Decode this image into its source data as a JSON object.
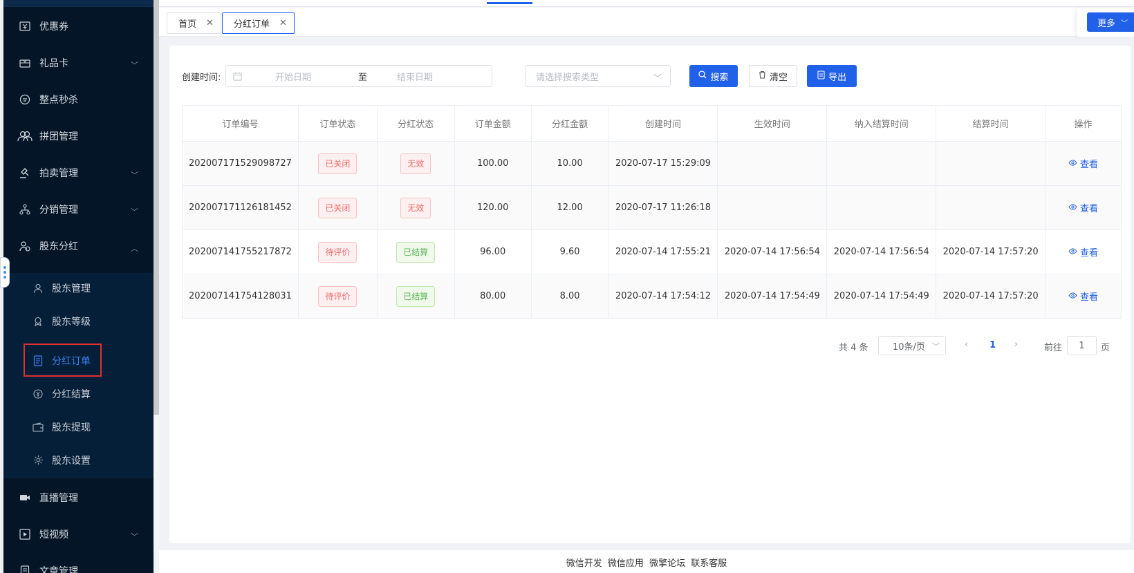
{
  "sidebar": {
    "items": [
      {
        "label": "优惠券",
        "icon": "coupon-icon"
      },
      {
        "label": "礼品卡",
        "icon": "gift-card-icon"
      },
      {
        "label": "整点秒杀",
        "icon": "flash-sale-icon"
      },
      {
        "label": "拼团管理",
        "icon": "group-buy-icon"
      },
      {
        "label": "拍卖管理",
        "icon": "auction-icon"
      },
      {
        "label": "分销管理",
        "icon": "distribution-icon"
      },
      {
        "label": "股东分红",
        "icon": "shareholder-icon"
      },
      {
        "label": "直播管理",
        "icon": "live-icon"
      },
      {
        "label": "短视频",
        "icon": "video-icon"
      },
      {
        "label": "文章管理",
        "icon": "article-icon"
      }
    ],
    "subitems": [
      {
        "label": "股东管理",
        "icon": "user-icon"
      },
      {
        "label": "股东等级",
        "icon": "level-icon"
      },
      {
        "label": "分红订单",
        "icon": "order-icon"
      },
      {
        "label": "分红结算",
        "icon": "settle-icon"
      },
      {
        "label": "股东提现",
        "icon": "wallet-icon"
      },
      {
        "label": "股东设置",
        "icon": "gear-icon"
      }
    ]
  },
  "tabs": [
    {
      "label": "首页"
    },
    {
      "label": "分红订单"
    }
  ],
  "more_label": "更多",
  "filter": {
    "label": "创建时间:",
    "start_placeholder": "开始日期",
    "separator": "至",
    "end_placeholder": "结束日期",
    "type_placeholder": "请选择搜索类型",
    "search_label": "搜索",
    "clear_label": "清空",
    "export_label": "导出"
  },
  "table": {
    "headers": [
      "订单编号",
      "订单状态",
      "分红状态",
      "订单金额",
      "分红金额",
      "创建时间",
      "生效时间",
      "纳入结算时间",
      "结算时间",
      "操作"
    ],
    "rows": [
      {
        "order_no": "202007171529098727",
        "order_status": "已关闭",
        "bonus_status": "无效",
        "amount": "100.00",
        "bonus": "10.00",
        "created": "2020-07-17 15:29:09",
        "effective": "",
        "included": "",
        "settled": "",
        "action": "查看"
      },
      {
        "order_no": "202007171126181452",
        "order_status": "已关闭",
        "bonus_status": "无效",
        "amount": "120.00",
        "bonus": "12.00",
        "created": "2020-07-17 11:26:18",
        "effective": "",
        "included": "",
        "settled": "",
        "action": "查看"
      },
      {
        "order_no": "202007141755217872",
        "order_status": "待评价",
        "bonus_status": "已结算",
        "amount": "96.00",
        "bonus": "9.60",
        "created": "2020-07-14 17:55:21",
        "effective": "2020-07-14 17:56:54",
        "included": "2020-07-14 17:56:54",
        "settled": "2020-07-14 17:57:20",
        "action": "查看"
      },
      {
        "order_no": "202007141754128031",
        "order_status": "待评价",
        "bonus_status": "已结算",
        "amount": "80.00",
        "bonus": "8.00",
        "created": "2020-07-14 17:54:12",
        "effective": "2020-07-14 17:54:49",
        "included": "2020-07-14 17:54:49",
        "settled": "2020-07-14 17:57:20",
        "action": "查看"
      }
    ]
  },
  "pagination": {
    "total": "共 4 条",
    "page_size": "10条/页",
    "current_page": "1",
    "goto_prefix": "前往",
    "goto_value": "1",
    "goto_suffix": "页"
  },
  "footer": {
    "links": [
      "微信开发",
      "微信应用",
      "微擎论坛",
      "联系客服"
    ]
  },
  "colors": {
    "sidebar_bg": "#041527",
    "primary": "#2160e8",
    "danger": "#ef6b6b",
    "success": "#5cb85c"
  }
}
